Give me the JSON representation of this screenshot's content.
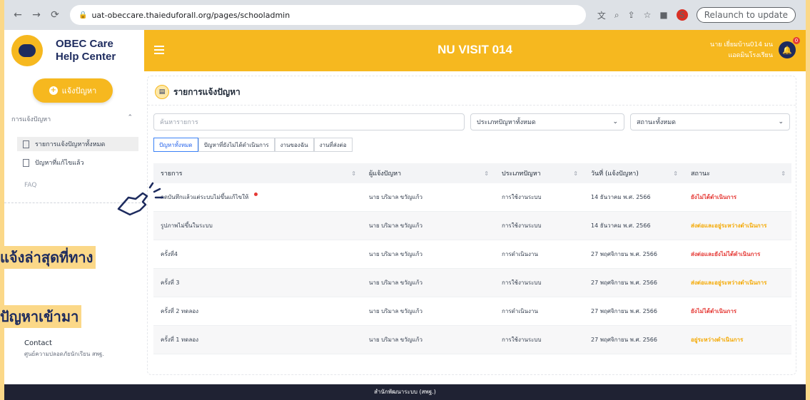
{
  "browser": {
    "url": "uat-obeccare.thaieduforall.org/pages/schooladmin",
    "relaunch_label": "Relaunch to update",
    "profile_initial": "S"
  },
  "brand": {
    "line1": "OBEC Care",
    "line2": "Help Center"
  },
  "sidebar": {
    "report_button": "แจ้งปัญหา",
    "section": "การแจ้งปัญหา",
    "items": [
      {
        "label": "รายการแจ้งปัญหาทั้งหมด",
        "active": true
      },
      {
        "label": "ปัญหาที่แก้ไขแล้ว",
        "active": false
      }
    ],
    "faq": "FAQ",
    "contact_title": "Contact",
    "contact_sub": "ศูนย์ความปลอดภัยนักเรียน สพฐ."
  },
  "topbar": {
    "title": "NU VISIT 014",
    "user_line1": "นาย เยี่ยมบ้าน014 มน",
    "user_line2": "แอดมินโรงเรียน",
    "notification_count": "0"
  },
  "card": {
    "title": "รายการแจ้งปัญหา",
    "search_placeholder": "ค้นหารายการ",
    "type_filter": "ประเภทปัญหาทั้งหมด",
    "status_filter": "สถานะทั้งหมด",
    "tabs": [
      "ปัญหาทั้งหมด",
      "ปัญหาที่ยังไม่ได้ดำเนินการ",
      "งานของฉัน",
      "งานที่ส่งต่อ"
    ]
  },
  "table": {
    "headers": [
      "รายการ",
      "ผู้แจ้งปัญหา",
      "ประเภทปัญหา",
      "วันที่ (แจ้งปัญหา)",
      "สถานะ"
    ],
    "rows": [
      {
        "item": "กดบันทึกแล้วแต่ระบบไม่ขึ้นแก้ไขให้",
        "reporter": "นาย บริมาล ขวัญแก้ว",
        "type": "การใช้งานระบบ",
        "date": "14 ธันวาคม พ.ศ. 2566",
        "status": "ยังไม่ได้ดำเนินการ",
        "status_color": "#e53935",
        "new": true
      },
      {
        "item": "รูปภาพไม่ขึ้นในระบบ",
        "reporter": "นาย บริมาล ขวัญแก้ว",
        "type": "การใช้งานระบบ",
        "date": "14 ธันวาคม พ.ศ. 2566",
        "status": "ส่งต่อและอยู่ระหว่างดำเนินการ",
        "status_color": "#f4a800",
        "new": false
      },
      {
        "item": "ครั้งที่4",
        "reporter": "นาย บริมาล ขวัญแก้ว",
        "type": "การดำเนินงาน",
        "date": "27 พฤศจิกายน พ.ศ. 2566",
        "status": "ส่งต่อและยังไม่ได้ดำเนินการ",
        "status_color": "#e53935",
        "new": false
      },
      {
        "item": "ครั้งที่ 3",
        "reporter": "นาย บริมาล ขวัญแก้ว",
        "type": "การใช้งานระบบ",
        "date": "27 พฤศจิกายน พ.ศ. 2566",
        "status": "ส่งต่อและอยู่ระหว่างดำเนินการ",
        "status_color": "#f4a800",
        "new": false
      },
      {
        "item": "ครั้งที่ 2 ทดลอง",
        "reporter": "นาย บริมาล ขวัญแก้ว",
        "type": "การดำเนินงาน",
        "date": "27 พฤศจิกายน พ.ศ. 2566",
        "status": "ยังไม่ได้ดำเนินการ",
        "status_color": "#e53935",
        "new": false
      },
      {
        "item": "ครั้งที่ 1 ทดลอง",
        "reporter": "นาย บริมาล ขวัญแก้ว",
        "type": "การใช้งานระบบ",
        "date": "27 พฤศจิกายน พ.ศ. 2566",
        "status": "อยู่ระหว่างดำเนินการ",
        "status_color": "#f4a800",
        "new": false
      }
    ]
  },
  "footer": {
    "text": "สำนักพัฒนาระบบ (สพฐ.)"
  },
  "overlay": {
    "line1": "แจ้งล่าสุดที่ทาง",
    "line2": "ปัญหาเข้ามา"
  }
}
